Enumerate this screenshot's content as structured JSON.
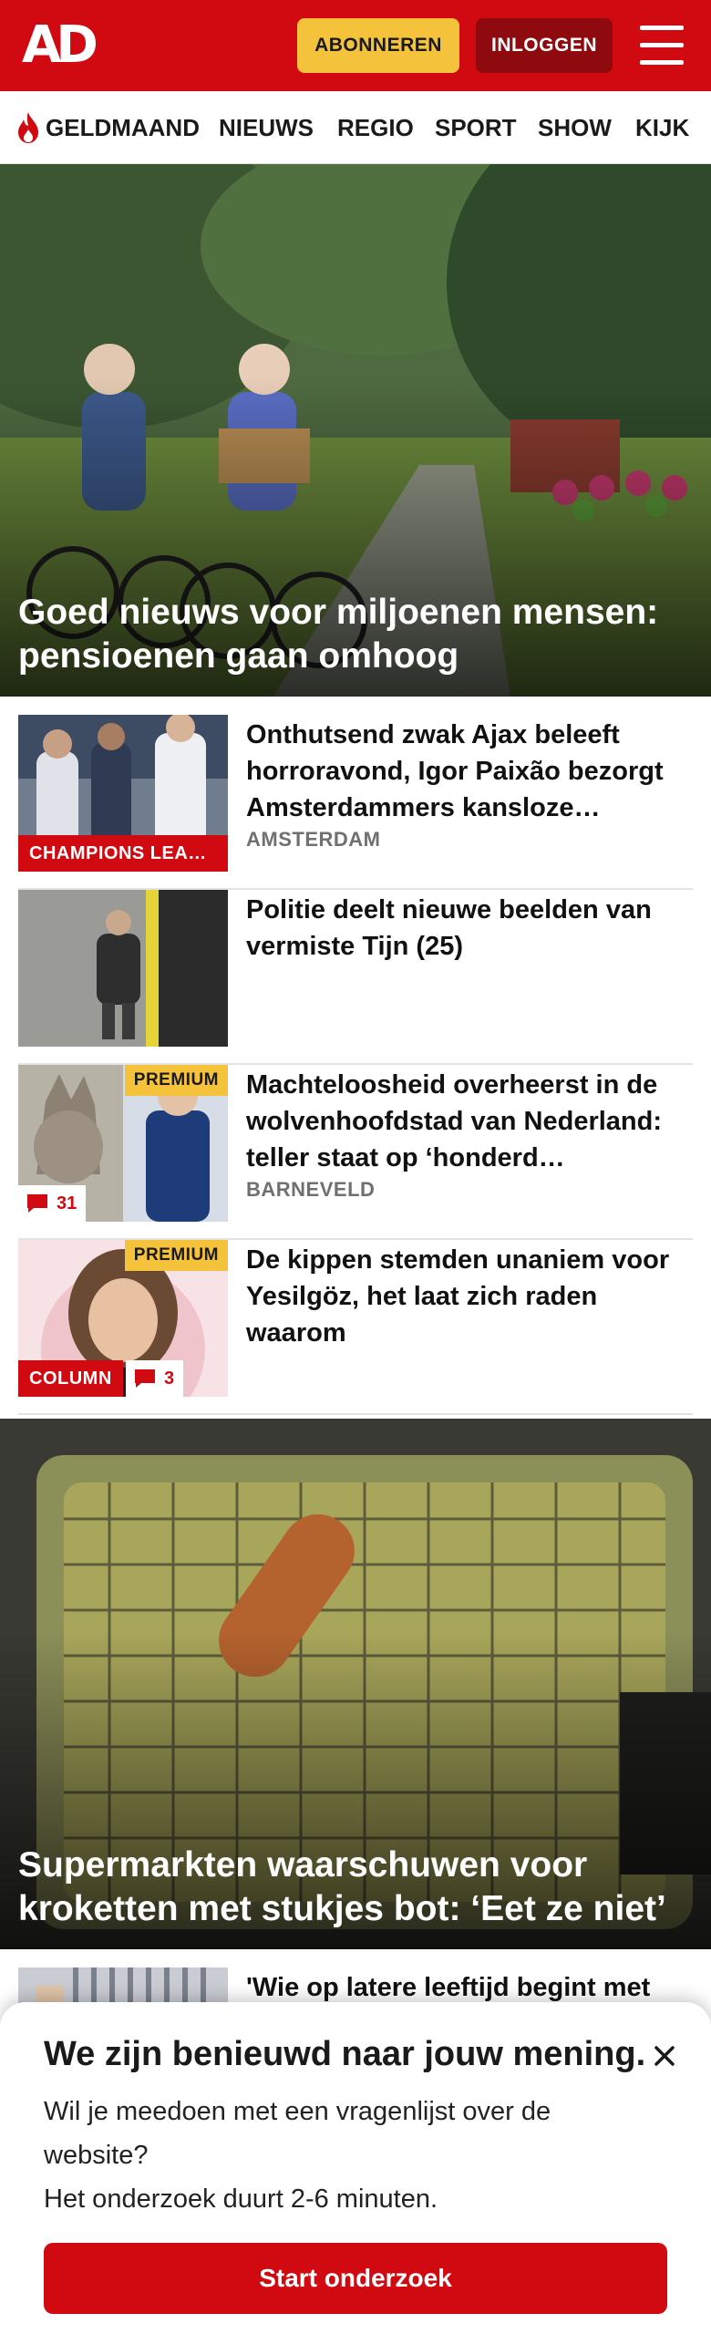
{
  "header": {
    "logo": "AD",
    "subscribe_label": "ABONNEREN",
    "login_label": "INLOGGEN"
  },
  "nav": {
    "items": [
      "GELDMAAND",
      "NIEUWS",
      "REGIO",
      "SPORT",
      "SHOW",
      "KIJK"
    ]
  },
  "hero1": {
    "title": "Goed nieuws voor miljoenen mensen: pensioenen gaan omhoog"
  },
  "articles": [
    {
      "title": "Onthutsend zwak Ajax beleeft horroravond, Igor Paixão bezorgt Amsterdammers kansloze…",
      "location": "AMSTERDAM",
      "badge": "CHAMPIONS LEA…"
    },
    {
      "title": "Politie deelt nieuwe beelden van vermiste Tijn (25)"
    },
    {
      "title": "Machteloosheid overheerst in de wolvenhoofdstad van Nederland: teller staat op ‘honderd…",
      "location": "BARNEVELD",
      "premium": "PREMIUM",
      "comments": "31"
    },
    {
      "title": "De kippen stemden unaniem voor Yesilgöz, het laat zich raden waarom",
      "premium": "PREMIUM",
      "badge": "COLUMN",
      "comments": "3"
    }
  ],
  "hero2": {
    "title": "Supermarkten waarschuwen voor kroketten met stukjes bot: ‘Eet ze niet’"
  },
  "partial_article": {
    "title": "'Wie op latere leeftijd begint met"
  },
  "survey": {
    "title": "We zijn benieuwd naar jouw mening.",
    "text_line1": "Wil je meedoen met een vragenlijst over de website?",
    "text_line2": "Het onderzoek duurt 2-6 minuten.",
    "button_label": "Start onderzoek"
  },
  "colors": {
    "brand_red": "#d10a11",
    "subscribe_yellow": "#f5c33b",
    "login_dark_red": "#8e0a0e"
  }
}
